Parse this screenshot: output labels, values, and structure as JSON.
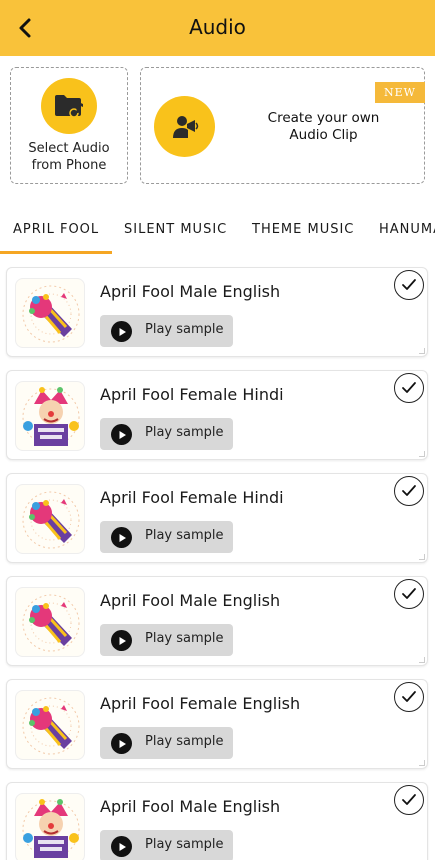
{
  "header": {
    "title": "Audio",
    "back_icon": "chevron-left-icon",
    "background": "#f9c23a"
  },
  "actions": {
    "select": {
      "label_line1": "Select Audio",
      "label_line2": "from Phone",
      "icon": "folder-music-icon"
    },
    "create": {
      "label_line1": "Create your own",
      "label_line2": "Audio Clip",
      "icon": "person-megaphone-icon",
      "badge": "NEW"
    }
  },
  "tabs": {
    "items": [
      {
        "label": "APRIL FOOL",
        "selected": true
      },
      {
        "label": "SILENT MUSIC",
        "selected": false
      },
      {
        "label": "THEME MUSIC",
        "selected": false
      },
      {
        "label": "HANUMAN",
        "selected": false
      }
    ],
    "indicator_color": "#f5a623"
  },
  "list": {
    "items": [
      {
        "title": "April Fool Male English",
        "play_label": "Play sample",
        "thumbnail": "party-horn-thumbnail"
      },
      {
        "title": "April Fool Female Hindi",
        "play_label": "Play sample",
        "thumbnail": "joker-banner-thumbnail"
      },
      {
        "title": "April Fool Female Hindi",
        "play_label": "Play sample",
        "thumbnail": "party-horn-thumbnail"
      },
      {
        "title": "April Fool Male English",
        "play_label": "Play sample",
        "thumbnail": "party-horn-thumbnail"
      },
      {
        "title": "April Fool Female English",
        "play_label": "Play sample",
        "thumbnail": "party-horn-thumbnail"
      },
      {
        "title": "April Fool Male English",
        "play_label": "Play sample",
        "thumbnail": "joker-banner-thumbnail"
      }
    ]
  }
}
